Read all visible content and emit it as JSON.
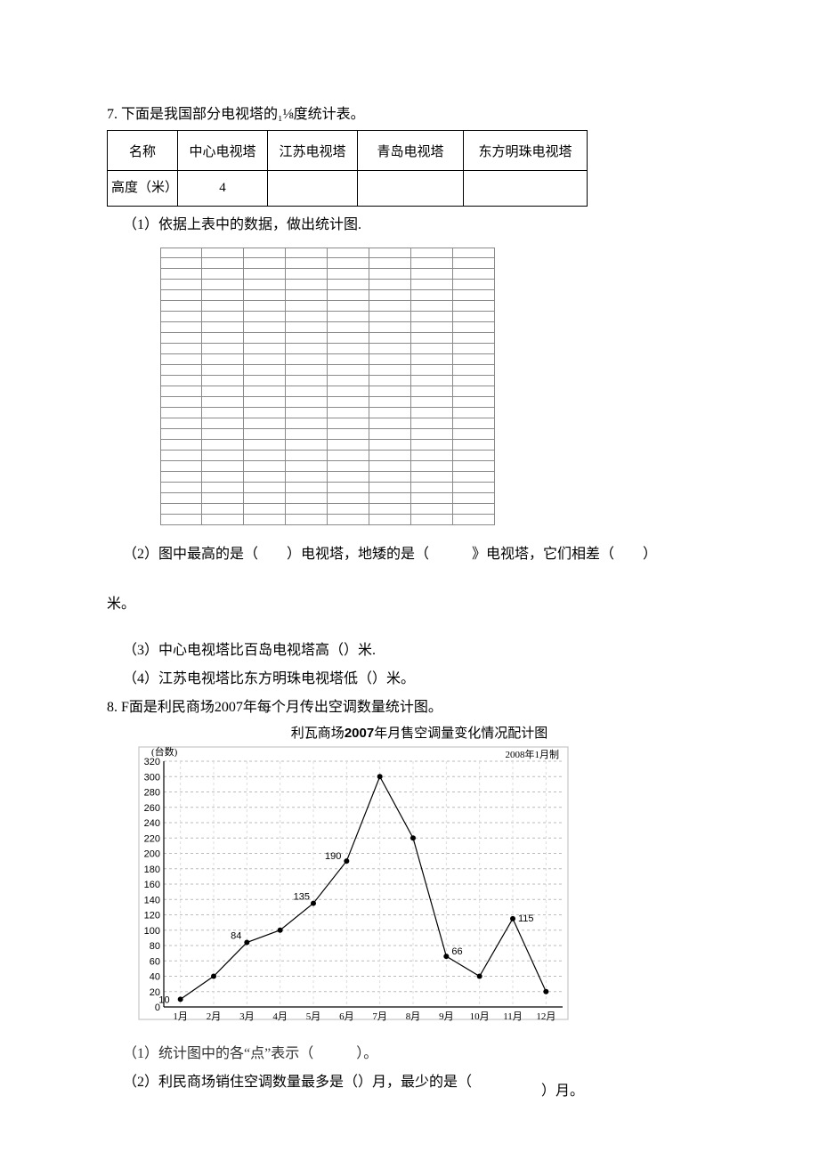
{
  "q7": {
    "title": "7. 下面是我国部分电视塔的₁⅛度统计表。",
    "table": {
      "head": [
        "名称",
        "中心电视塔",
        "江苏电视塔",
        "青岛电视塔",
        "东方明珠电视塔"
      ],
      "row_label": "高度（米）",
      "row_values": [
        "4",
        "",
        "",
        ""
      ]
    },
    "sub1": "（1）依据上表中的数据，做出统计图.",
    "sub2_a": "（2）图中最高的是（　　）电视塔，地矮的是（　　　》电视塔，它们相差（　　）",
    "sub2_b": "米。",
    "sub3": "（3）中心电视塔比百岛电视塔高（）米.",
    "sub4": "（4）江苏电视塔比东方明珠电视塔低（）米。"
  },
  "q8": {
    "title": "8. F面是利民商场2007年每个月传出空调数量统计图。",
    "chart_title_pre": "利瓦商场",
    "chart_title_year": "2007",
    "chart_title_post": "年月售空调量变化情况配计图",
    "chart_made": "2008年1月制",
    "chart_unit": "(台数)",
    "sub1": "（1）统计图中的各“点”表示（　　　）。",
    "sub2_a": "（2）利民商场销住空调数量最多是（）月，最少的是（",
    "sub2_b": "）月。"
  },
  "chart_data": {
    "type": "line",
    "title": "利瓦商场2007年月售空调量变化情况配计图",
    "xlabel": "",
    "ylabel": "(台数)",
    "ylim": [
      0,
      320
    ],
    "ytick": 20,
    "categories": [
      "1月",
      "2月",
      "3月",
      "4月",
      "5月",
      "6月",
      "7月",
      "8月",
      "9月",
      "10月",
      "11月",
      "12月"
    ],
    "values": [
      10,
      40,
      84,
      100,
      135,
      190,
      300,
      220,
      66,
      40,
      115,
      20
    ],
    "point_labels": {
      "1月": "10",
      "3月": "84",
      "5月": "135",
      "6月": "190",
      "9月": "66",
      "11月": "115"
    }
  }
}
